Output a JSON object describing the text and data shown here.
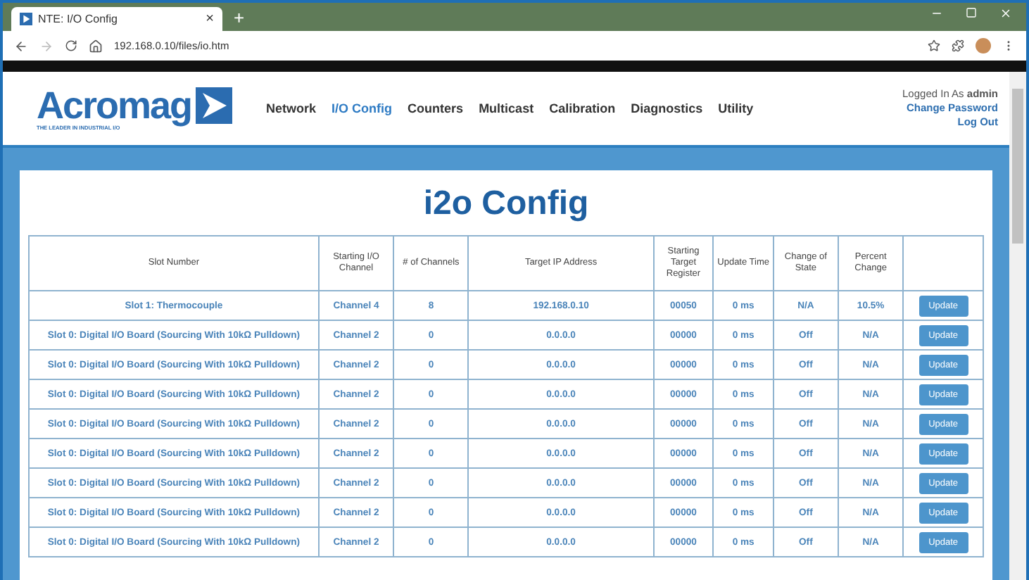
{
  "browser": {
    "tab_title": "NTE: I/O Config",
    "tab_close": "×",
    "new_tab": "+",
    "url": "192.168.0.10/files/io.htm"
  },
  "header": {
    "logo": "Acromag",
    "tagline": "THE LEADER IN INDUSTRIAL I/O",
    "nav": [
      {
        "label": "Network",
        "selected": false
      },
      {
        "label": "I/O Config",
        "selected": true
      },
      {
        "label": "Counters",
        "selected": false
      },
      {
        "label": "Multicast",
        "selected": false
      },
      {
        "label": "Calibration",
        "selected": false
      },
      {
        "label": "Diagnostics",
        "selected": false
      },
      {
        "label": "Utility",
        "selected": false
      }
    ],
    "user": {
      "prefix": "Logged In As",
      "name": "admin",
      "links": [
        "Change Password",
        "Log Out"
      ]
    }
  },
  "page_title": "i2o Config",
  "table": {
    "columns": [
      "Slot Number",
      "Starting I/O Channel",
      "# of Channels",
      "Target IP Address",
      "Starting Target Register",
      "Update Time",
      "Change of State",
      "Percent Change"
    ],
    "rows": [
      {
        "cells": [
          "Slot 1: Thermocouple",
          "Channel 4",
          "8",
          "192.168.0.10",
          "00050",
          "0 ms",
          "N/A",
          "10.5%"
        ],
        "action": "Update"
      },
      {
        "cells": [
          "Slot 0: Digital I/O Board (Sourcing With 10kΩ Pulldown)",
          "Channel 2",
          "0",
          "0.0.0.0",
          "00000",
          "0 ms",
          "Off",
          "N/A"
        ],
        "action": "Update"
      },
      {
        "cells": [
          "Slot 0: Digital I/O Board (Sourcing With 10kΩ Pulldown)",
          "Channel 2",
          "0",
          "0.0.0.0",
          "00000",
          "0 ms",
          "Off",
          "N/A"
        ],
        "action": "Update"
      },
      {
        "cells": [
          "Slot 0: Digital I/O Board (Sourcing With 10kΩ Pulldown)",
          "Channel 2",
          "0",
          "0.0.0.0",
          "00000",
          "0 ms",
          "Off",
          "N/A"
        ],
        "action": "Update"
      },
      {
        "cells": [
          "Slot 0: Digital I/O Board (Sourcing With 10kΩ Pulldown)",
          "Channel 2",
          "0",
          "0.0.0.0",
          "00000",
          "0 ms",
          "Off",
          "N/A"
        ],
        "action": "Update"
      },
      {
        "cells": [
          "Slot 0: Digital I/O Board (Sourcing With 10kΩ Pulldown)",
          "Channel 2",
          "0",
          "0.0.0.0",
          "00000",
          "0 ms",
          "Off",
          "N/A"
        ],
        "action": "Update"
      },
      {
        "cells": [
          "Slot 0: Digital I/O Board (Sourcing With 10kΩ Pulldown)",
          "Channel 2",
          "0",
          "0.0.0.0",
          "00000",
          "0 ms",
          "Off",
          "N/A"
        ],
        "action": "Update"
      },
      {
        "cells": [
          "Slot 0: Digital I/O Board (Sourcing With 10kΩ Pulldown)",
          "Channel 2",
          "0",
          "0.0.0.0",
          "00000",
          "0 ms",
          "Off",
          "N/A"
        ],
        "action": "Update"
      },
      {
        "cells": [
          "Slot 0: Digital I/O Board (Sourcing With 10kΩ Pulldown)",
          "Channel 2",
          "0",
          "0.0.0.0",
          "00000",
          "0 ms",
          "Off",
          "N/A"
        ],
        "action": "Update"
      }
    ]
  }
}
